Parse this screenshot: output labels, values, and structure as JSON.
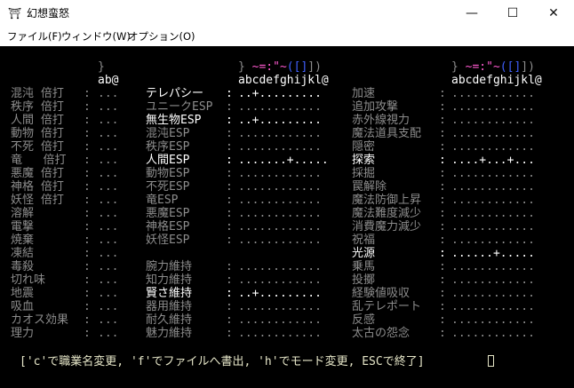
{
  "window": {
    "title": "幻想蛮怒",
    "icon": "game-app-icon",
    "controls": {
      "minimize": "—",
      "maximize": "☐",
      "close": "✕"
    }
  },
  "menu": [
    "ファイル(F)",
    "ウィンドウ(W)",
    "オプション(O)"
  ],
  "headers": {
    "col1_sym": "}",
    "col1_letters": "ab@",
    "col2_sym_prefix": "} ",
    "col2_sym_mid": "~=:\"~",
    "col2_sym_br": "([]",
    "col2_sym_end": "])",
    "col2_letters": "abcdefghijkl@",
    "col3_sym_prefix": "} ",
    "col3_sym_mid": "~=:\"~",
    "col3_sym_br": "([]",
    "col3_sym_end": "])",
    "col3_letters": "abcdefghijkl@"
  },
  "col1": [
    {
      "label": "混沌 倍打",
      "sep": ":",
      "value": "..."
    },
    {
      "label": "秩序 倍打",
      "sep": ":",
      "value": "..."
    },
    {
      "label": "人間 倍打",
      "sep": ":",
      "value": "..."
    },
    {
      "label": "動物 倍打",
      "sep": ":",
      "value": "..."
    },
    {
      "label": "不死 倍打",
      "sep": ":",
      "value": "..."
    },
    {
      "label": "竜   倍打",
      "sep": ":",
      "value": "..."
    },
    {
      "label": "悪魔 倍打",
      "sep": ":",
      "value": "..."
    },
    {
      "label": "神格 倍打",
      "sep": ":",
      "value": "..."
    },
    {
      "label": "妖怪 倍打",
      "sep": ":",
      "value": "..."
    },
    {
      "label": "溶解",
      "sep": ":",
      "value": "..."
    },
    {
      "label": "電撃",
      "sep": ":",
      "value": "..."
    },
    {
      "label": "焼棄",
      "sep": ":",
      "value": "..."
    },
    {
      "label": "凍結",
      "sep": ":",
      "value": "..."
    },
    {
      "label": "毒殺",
      "sep": ":",
      "value": "..."
    },
    {
      "label": "切れ味",
      "sep": ":",
      "value": "..."
    },
    {
      "label": "地震",
      "sep": ":",
      "value": "..."
    },
    {
      "label": "吸血",
      "sep": ":",
      "value": "..."
    },
    {
      "label": "カオス効果",
      "sep": ":",
      "value": "..."
    },
    {
      "label": "理力",
      "sep": ":",
      "value": "..."
    }
  ],
  "col2": [
    {
      "label": "テレパシー",
      "sep": ":",
      "value": "..+.........",
      "active": true
    },
    {
      "label": "ユニークESP",
      "sep": ":",
      "value": "............",
      "active": false
    },
    {
      "label": "無生物ESP",
      "sep": ":",
      "value": "..+.........",
      "active": true
    },
    {
      "label": "混沌ESP",
      "sep": ":",
      "value": "............",
      "active": false
    },
    {
      "label": "秩序ESP",
      "sep": ":",
      "value": "............",
      "active": false
    },
    {
      "label": "人間ESP",
      "sep": ":",
      "value": ".......+.....",
      "active": true
    },
    {
      "label": "動物ESP",
      "sep": ":",
      "value": "............",
      "active": false
    },
    {
      "label": "不死ESP",
      "sep": ":",
      "value": "............",
      "active": false
    },
    {
      "label": "竜ESP",
      "sep": ":",
      "value": "............",
      "active": false
    },
    {
      "label": "悪魔ESP",
      "sep": ":",
      "value": "............",
      "active": false
    },
    {
      "label": "神格ESP",
      "sep": ":",
      "value": "............",
      "active": false
    },
    {
      "label": "妖怪ESP",
      "sep": ":",
      "value": "............",
      "active": false
    },
    {
      "label": "",
      "sep": "",
      "value": "",
      "active": false
    },
    {
      "label": "腕力維持",
      "sep": ":",
      "value": "............",
      "active": false
    },
    {
      "label": "知力維持",
      "sep": ":",
      "value": "............",
      "active": false
    },
    {
      "label": "賢さ維持",
      "sep": ":",
      "value": "..+.........",
      "active": true
    },
    {
      "label": "器用維持",
      "sep": ":",
      "value": "............",
      "active": false
    },
    {
      "label": "耐久維持",
      "sep": ":",
      "value": "............",
      "active": false
    },
    {
      "label": "魅力維持",
      "sep": ":",
      "value": "............",
      "active": false
    }
  ],
  "col3": [
    {
      "label": "加速",
      "sep": ":",
      "value": "............",
      "active": false
    },
    {
      "label": "追加攻撃",
      "sep": ":",
      "value": "............",
      "active": false
    },
    {
      "label": "赤外線視力",
      "sep": ":",
      "value": "............",
      "active": false
    },
    {
      "label": "魔法道具支配",
      "sep": ":",
      "value": "............",
      "active": false
    },
    {
      "label": "隠密",
      "sep": ":",
      "value": "............",
      "active": false
    },
    {
      "label": "探索",
      "sep": ":",
      "value": "....+...+...",
      "active": true
    },
    {
      "label": "採掘",
      "sep": ":",
      "value": "............",
      "active": false
    },
    {
      "label": "罠解除",
      "sep": ":",
      "value": "............",
      "active": false
    },
    {
      "label": "魔法防御上昇",
      "sep": ":",
      "value": "............",
      "active": false
    },
    {
      "label": "魔法難度減少",
      "sep": ":",
      "value": "............",
      "active": false
    },
    {
      "label": "消費魔力減少",
      "sep": ":",
      "value": "............",
      "active": false
    },
    {
      "label": "祝福",
      "sep": ":",
      "value": "............",
      "active": false
    },
    {
      "label": "光源",
      "sep": ":",
      "value": "......+.....",
      "active": true
    },
    {
      "label": "乗馬",
      "sep": ":",
      "value": "............",
      "active": false
    },
    {
      "label": "投擲",
      "sep": ":",
      "value": "............",
      "active": false
    },
    {
      "label": "経験値吸収",
      "sep": ":",
      "value": "............",
      "active": false
    },
    {
      "label": "乱テレポート",
      "sep": ":",
      "value": "............",
      "active": false
    },
    {
      "label": "反感",
      "sep": ":",
      "value": "............",
      "active": false
    },
    {
      "label": "太古の怨念",
      "sep": ":",
      "value": "............",
      "active": false
    }
  ],
  "status_line": "['c'で職業名変更, 'f'でファイルへ書出, 'h'でモード変更, ESCで終了]",
  "colors": {
    "terminal_bg": "#000000",
    "active_text": "#ffffff",
    "inactive_text": "#8c8c8c",
    "blue": "#4060ff",
    "pink": "#ff5ad0"
  }
}
